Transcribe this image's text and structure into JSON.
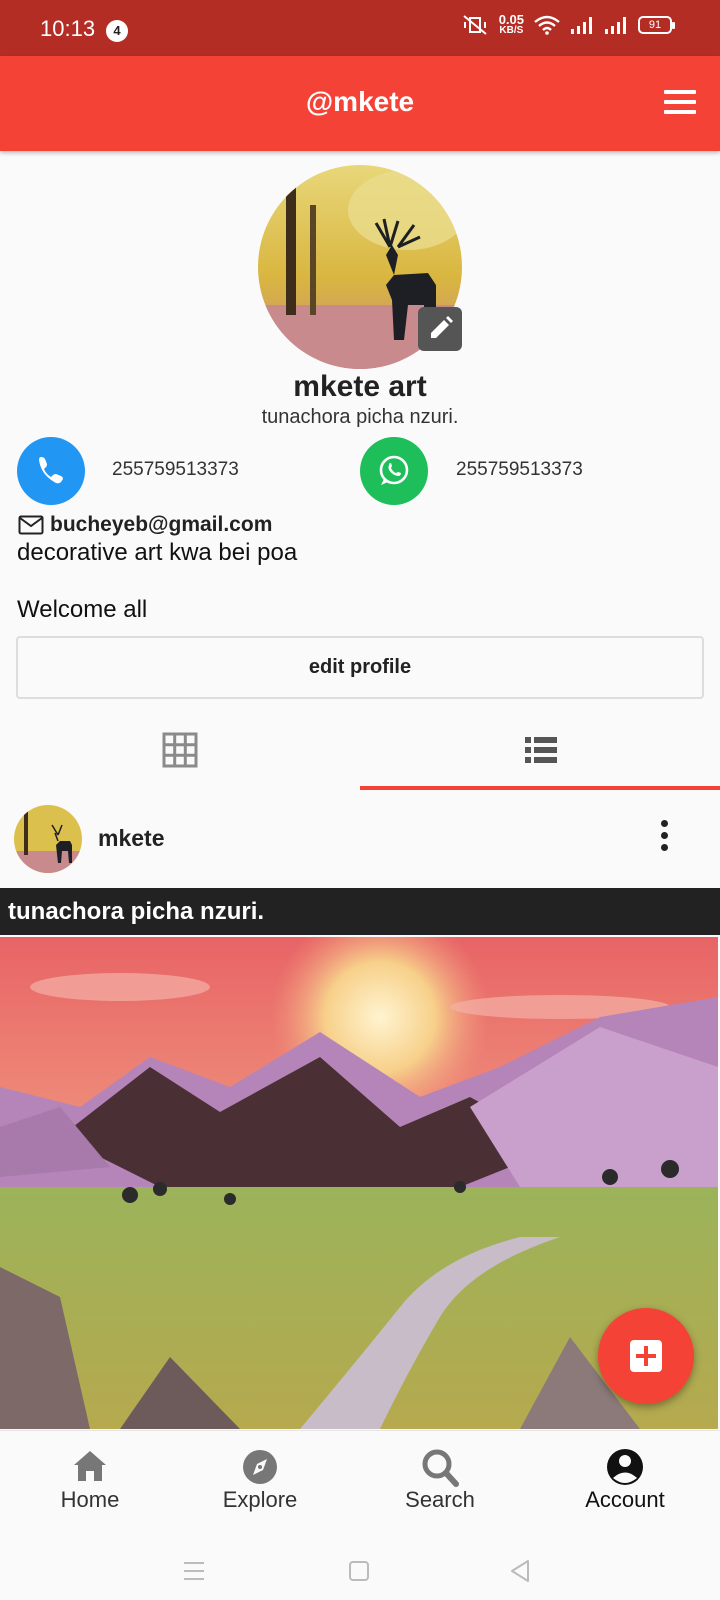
{
  "status_bar": {
    "time": "10:13",
    "notification_count": "4",
    "net_speed_value": "0.05",
    "net_speed_unit": "KB/S",
    "battery": "91"
  },
  "app_bar": {
    "title": "@mkete",
    "menu_icon": "hamburger-menu-icon"
  },
  "profile": {
    "display_name": "mkete art",
    "bio": "tunachora picha nzuri.",
    "phone": "255759513373",
    "whatsapp": "255759513373",
    "email": "bucheyeb@gmail.com",
    "description_line1": "decorative art kwa bei poa",
    "description_line2": "Welcome all",
    "edit_button": "edit profile"
  },
  "tabs": [
    {
      "icon": "grid-icon",
      "selected": false
    },
    {
      "icon": "list-icon",
      "selected": true
    }
  ],
  "post": {
    "username": "mkete",
    "caption": "tunachora picha nzuri."
  },
  "bottom_nav": {
    "items": [
      {
        "label": "Home",
        "icon": "home-icon",
        "active": false
      },
      {
        "label": "Explore",
        "icon": "compass-icon",
        "active": false
      },
      {
        "label": "Search",
        "icon": "search-icon",
        "active": false
      },
      {
        "label": "Account",
        "icon": "account-icon",
        "active": true
      }
    ]
  },
  "colors": {
    "status_bar": "#b32d25",
    "app_bar": "#f44336",
    "phone_button": "#2196f3",
    "whatsapp_button": "#1ebe5a",
    "fab": "#f44336"
  }
}
